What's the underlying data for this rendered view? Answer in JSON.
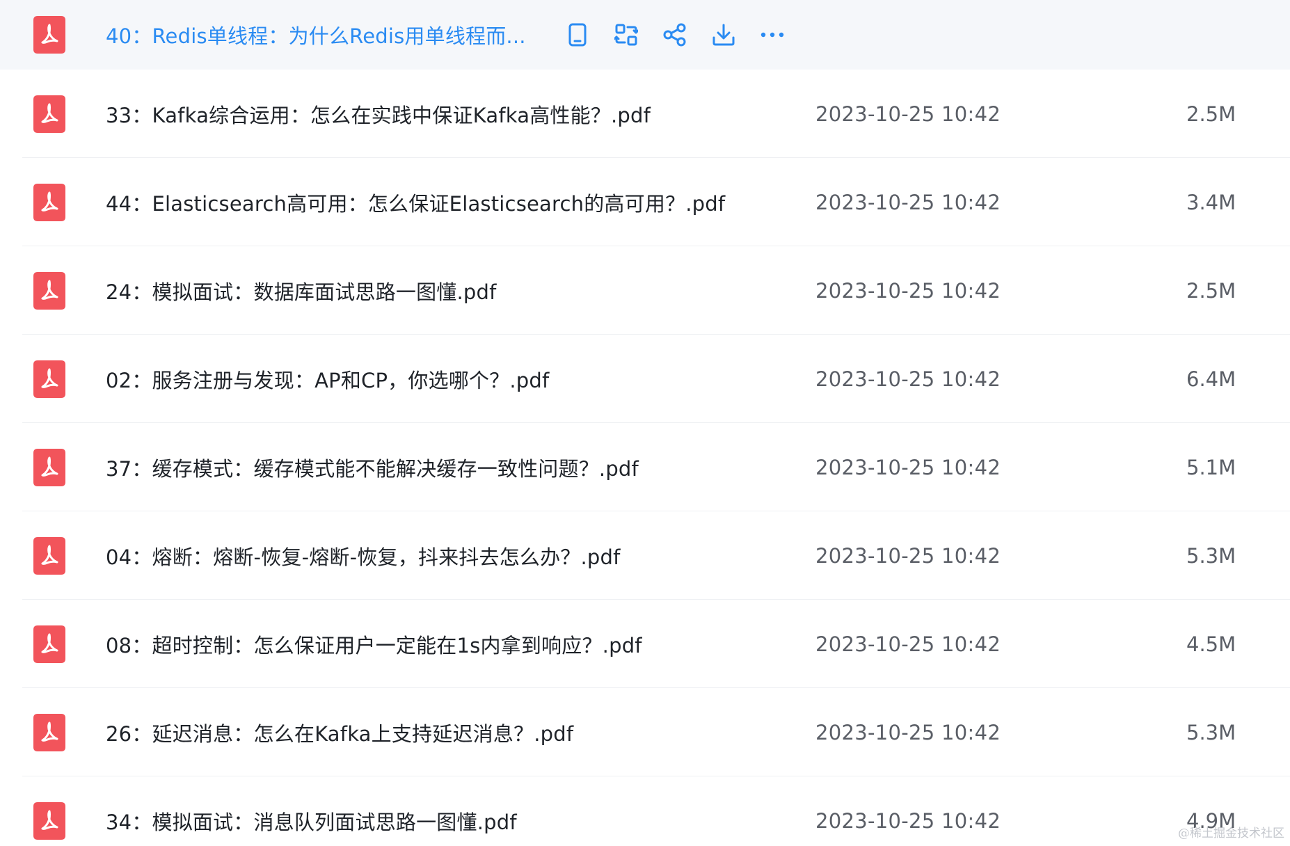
{
  "accent_color": "#2a8bf2",
  "pdf_icon_color": "#f2545b",
  "hovered_row": {
    "name": "40：Redis单线程：为什么Redis用单线程而...",
    "actions": [
      {
        "icon": "mobile-phone-icon"
      },
      {
        "icon": "transfer-icon"
      },
      {
        "icon": "share-icon"
      },
      {
        "icon": "download-icon"
      },
      {
        "icon": "more-icon"
      }
    ]
  },
  "files": [
    {
      "name": "33：Kafka综合运用：怎么在实践中保证Kafka高性能？.pdf",
      "date": "2023-10-25 10:42",
      "size": "2.5M"
    },
    {
      "name": "44：Elasticsearch高可用：怎么保证Elasticsearch的高可用？.pdf",
      "date": "2023-10-25 10:42",
      "size": "3.4M"
    },
    {
      "name": "24：模拟面试：数据库面试思路一图懂.pdf",
      "date": "2023-10-25 10:42",
      "size": "2.5M"
    },
    {
      "name": "02：服务注册与发现：AP和CP，你选哪个？.pdf",
      "date": "2023-10-25 10:42",
      "size": "6.4M"
    },
    {
      "name": "37：缓存模式：缓存模式能不能解决缓存一致性问题？.pdf",
      "date": "2023-10-25 10:42",
      "size": "5.1M"
    },
    {
      "name": "04：熔断：熔断-恢复-熔断-恢复，抖来抖去怎么办？.pdf",
      "date": "2023-10-25 10:42",
      "size": "5.3M"
    },
    {
      "name": "08：超时控制：怎么保证用户一定能在1s内拿到响应？.pdf",
      "date": "2023-10-25 10:42",
      "size": "4.5M"
    },
    {
      "name": "26：延迟消息：怎么在Kafka上支持延迟消息？.pdf",
      "date": "2023-10-25 10:42",
      "size": "5.3M"
    },
    {
      "name": "34：模拟面试：消息队列面试思路一图懂.pdf",
      "date": "2023-10-25 10:42",
      "size": "4.9M"
    }
  ],
  "watermark": "@稀土掘金技术社区"
}
